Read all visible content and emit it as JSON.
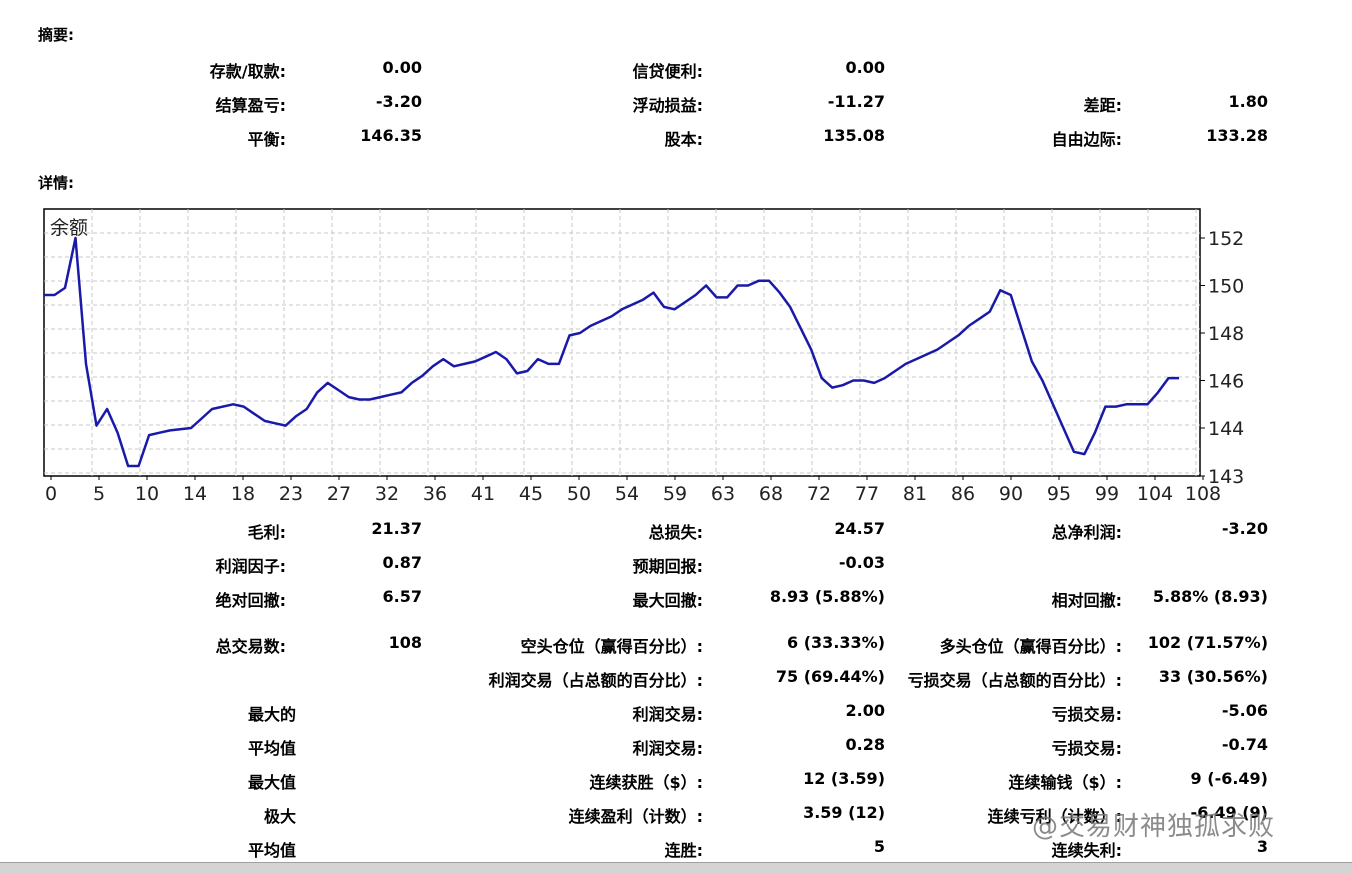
{
  "summary": {
    "section_title": "摘要:",
    "deposit_label": "存款/取款:",
    "deposit_value": "0.00",
    "credit_label": "信贷便利:",
    "credit_value": "0.00",
    "closed_pl_label": "结算盈亏:",
    "closed_pl_value": "-3.20",
    "floating_pl_label": "浮动损益:",
    "floating_pl_value": "-11.27",
    "spread_label": "差距:",
    "spread_value": "1.80",
    "balance_label": "平衡:",
    "balance_value": "146.35",
    "equity_label": "股本:",
    "equity_value": "135.08",
    "free_margin_label": "自由边际:",
    "free_margin_value": "133.28"
  },
  "details": {
    "section_title": "详情:",
    "gross_profit_label": "毛利:",
    "gross_profit_value": "21.37",
    "gross_loss_label": "总损失:",
    "gross_loss_value": "24.57",
    "net_profit_label": "总净利润:",
    "net_profit_value": "-3.20",
    "profit_factor_label": "利润因子:",
    "profit_factor_value": "0.87",
    "expected_payoff_label": "预期回报:",
    "expected_payoff_value": "-0.03",
    "abs_drawdown_label": "绝对回撤:",
    "abs_drawdown_value": "6.57",
    "max_drawdown_label": "最大回撤:",
    "max_drawdown_value": "8.93 (5.88%)",
    "rel_drawdown_label": "相对回撤:",
    "rel_drawdown_value": "5.88% (8.93)",
    "total_trades_label": "总交易数:",
    "total_trades_value": "108",
    "short_label": "空头仓位（赢得百分比）:",
    "short_value": "6 (33.33%)",
    "long_label": "多头仓位（赢得百分比）:",
    "long_value": "102 (71.57%)",
    "profit_trades_label": "利润交易（占总额的百分比）:",
    "profit_trades_value": "75 (69.44%)",
    "loss_trades_label": "亏损交易（占总额的百分比）:",
    "loss_trades_value": "33 (30.56%)",
    "largest_label": "最大的",
    "largest_profit_label": "利润交易:",
    "largest_profit_value": "2.00",
    "largest_loss_label": "亏损交易:",
    "largest_loss_value": "-5.06",
    "average_label": "平均值",
    "avg_profit_label": "利润交易:",
    "avg_profit_value": "0.28",
    "avg_loss_label": "亏损交易:",
    "avg_loss_value": "-0.74",
    "maximum_label": "最大值",
    "max_consec_wins_label": "连续获胜（$）:",
    "max_consec_wins_value": "12 (3.59)",
    "max_consec_losses_label": "连续输钱（$）:",
    "max_consec_losses_value": "9 (-6.49)",
    "maximal_label": "极大",
    "maximal_consec_profit_label": "连续盈利（计数）:",
    "maximal_consec_profit_value": "3.59 (12)",
    "maximal_consec_loss_label": "连续亏利（计数）:",
    "maximal_consec_loss_value": "-6.49 (9)",
    "average2_label": "平均值",
    "avg_consec_wins_label": "连胜:",
    "avg_consec_wins_value": "5",
    "avg_consec_losses_label": "连续失利:",
    "avg_consec_losses_value": "3"
  },
  "watermark": "@交易财神独孤求败",
  "chart_data": {
    "type": "line",
    "title": "余额",
    "line_color": "#1a1aa8",
    "grid": true,
    "ylim": [
      143,
      153
    ],
    "yticks": [
      152,
      150,
      148,
      146,
      144,
      143
    ],
    "xticks": [
      0,
      5,
      10,
      14,
      18,
      23,
      27,
      32,
      36,
      41,
      45,
      50,
      54,
      59,
      63,
      68,
      72,
      77,
      81,
      86,
      90,
      95,
      99,
      104,
      108
    ],
    "xlim": [
      0,
      110
    ],
    "x": [
      0,
      1,
      2,
      3,
      4,
      5,
      6,
      7,
      8,
      9,
      10,
      11,
      12,
      14,
      16,
      18,
      19,
      20,
      21,
      22,
      23,
      24,
      25,
      26,
      27,
      28,
      29,
      30,
      31,
      32,
      33,
      34,
      35,
      36,
      37,
      38,
      39,
      40,
      41,
      42,
      43,
      44,
      45,
      46,
      47,
      48,
      49,
      50,
      51,
      52,
      53,
      54,
      55,
      56,
      57,
      58,
      59,
      60,
      61,
      62,
      63,
      64,
      65,
      66,
      67,
      68,
      69,
      70,
      71,
      72,
      73,
      74,
      75,
      76,
      77,
      78,
      79,
      80,
      81,
      82,
      83,
      84,
      85,
      86,
      87,
      88,
      89,
      90,
      91,
      92,
      93,
      94,
      95,
      96,
      97,
      98,
      99,
      100,
      101,
      102,
      103,
      104,
      105,
      106,
      107,
      108,
      109,
      110
    ],
    "y": [
      149.6,
      149.6,
      149.9,
      152.0,
      146.7,
      144.1,
      144.8,
      143.8,
      142.4,
      142.4,
      143.7,
      143.8,
      143.9,
      144.0,
      144.8,
      145.0,
      144.9,
      144.6,
      144.3,
      144.2,
      144.1,
      144.5,
      144.8,
      145.5,
      145.9,
      145.6,
      145.3,
      145.2,
      145.2,
      145.3,
      145.4,
      145.5,
      145.9,
      146.2,
      146.6,
      146.9,
      146.6,
      146.7,
      146.8,
      147.0,
      147.2,
      146.9,
      146.3,
      146.4,
      146.9,
      146.7,
      146.7,
      147.9,
      148.0,
      148.3,
      148.5,
      148.7,
      149.0,
      149.2,
      149.4,
      149.7,
      149.1,
      149.0,
      149.3,
      149.6,
      150.0,
      149.5,
      149.5,
      150.0,
      150.0,
      150.2,
      150.2,
      149.7,
      149.1,
      148.2,
      147.3,
      146.1,
      145.7,
      145.8,
      146.0,
      146.0,
      145.9,
      146.1,
      146.4,
      146.7,
      146.9,
      147.1,
      147.3,
      147.6,
      147.9,
      148.3,
      148.6,
      148.9,
      149.8,
      149.6,
      148.2,
      146.8,
      146.0,
      145.0,
      144.0,
      143.0,
      142.9,
      143.8,
      144.9,
      144.9,
      145.0,
      145.0,
      145.0,
      145.5,
      146.1,
      146.1
    ]
  }
}
